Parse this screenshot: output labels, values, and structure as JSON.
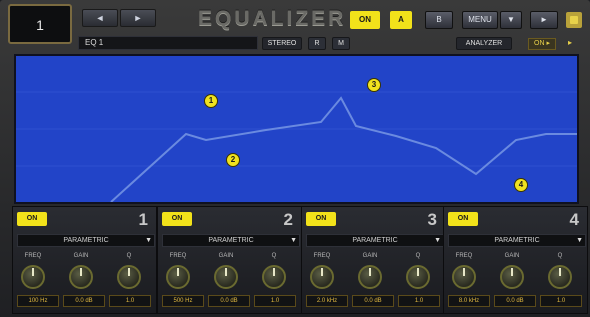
{
  "header": {
    "slot_number": "1",
    "prev_glyph": "◄",
    "next_glyph": "►",
    "title": "EQUALIZER",
    "on_label": "ON",
    "a_label": "A",
    "b_label": "B",
    "menu_label": "MENU",
    "menu_arrow": "▼",
    "play_glyph": "►"
  },
  "subbar": {
    "preset_name": "EQ 1",
    "stereo_label": "STEREO",
    "r_label": "R",
    "m_label": "M",
    "analyzer_label": "ANALYZER",
    "right_btn_label": "ON ▸",
    "right_arrow": "▸"
  },
  "graph": {
    "markers": [
      "1",
      "2",
      "3",
      "4"
    ],
    "curve_color": "#6a8ae0",
    "bg_color": "#2244c8"
  },
  "bands": [
    {
      "on_label": "ON",
      "number": "1",
      "type": "PARAMETRIC",
      "knob_labels": [
        "FREQ",
        "GAIN",
        "Q"
      ],
      "values": [
        "100 Hz",
        "0.0 dB",
        "1.0"
      ]
    },
    {
      "on_label": "ON",
      "number": "2",
      "type": "PARAMETRIC",
      "knob_labels": [
        "FREQ",
        "GAIN",
        "Q"
      ],
      "values": [
        "500 Hz",
        "0.0 dB",
        "1.0"
      ]
    },
    {
      "on_label": "ON",
      "number": "3",
      "type": "PARAMETRIC",
      "knob_labels": [
        "FREQ",
        "GAIN",
        "Q"
      ],
      "values": [
        "2.0 kHz",
        "0.0 dB",
        "1.0"
      ]
    },
    {
      "on_label": "ON",
      "number": "4",
      "type": "PARAMETRIC",
      "knob_labels": [
        "FREQ",
        "GAIN",
        "Q"
      ],
      "values": [
        "8.0 kHz",
        "0.0 dB",
        "1.0"
      ]
    }
  ],
  "colors": {
    "accent_yellow": "#f2e21a",
    "value_text": "#e0b840"
  }
}
